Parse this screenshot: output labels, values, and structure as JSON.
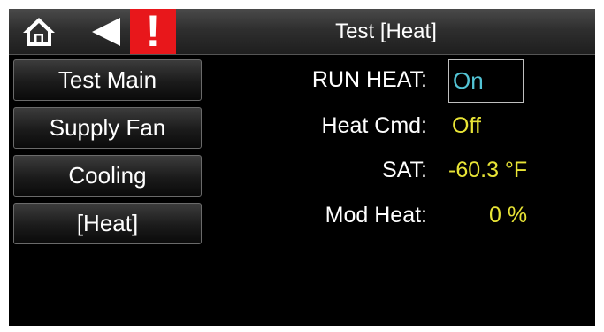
{
  "header": {
    "title": "Test [Heat]",
    "home_icon": "home-icon",
    "back_icon": "back-arrow-icon",
    "alarm_icon": "alarm-exclamation-icon",
    "alarm_glyph": "!",
    "alarm_color": "#e8171b"
  },
  "nav": {
    "items": [
      {
        "label": "Test Main"
      },
      {
        "label": "Supply Fan"
      },
      {
        "label": "Cooling"
      },
      {
        "label": "[Heat]"
      }
    ]
  },
  "fields": {
    "run_heat": {
      "label": "RUN HEAT:",
      "value": "On",
      "color": "#52c3d4"
    },
    "heat_cmd": {
      "label": "Heat Cmd:",
      "value": "Off"
    },
    "sat": {
      "label": "SAT:",
      "value": "-60.3 °F"
    },
    "mod_heat": {
      "label": "Mod Heat:",
      "value": "0 %"
    },
    "value_color": "#e8e436"
  }
}
